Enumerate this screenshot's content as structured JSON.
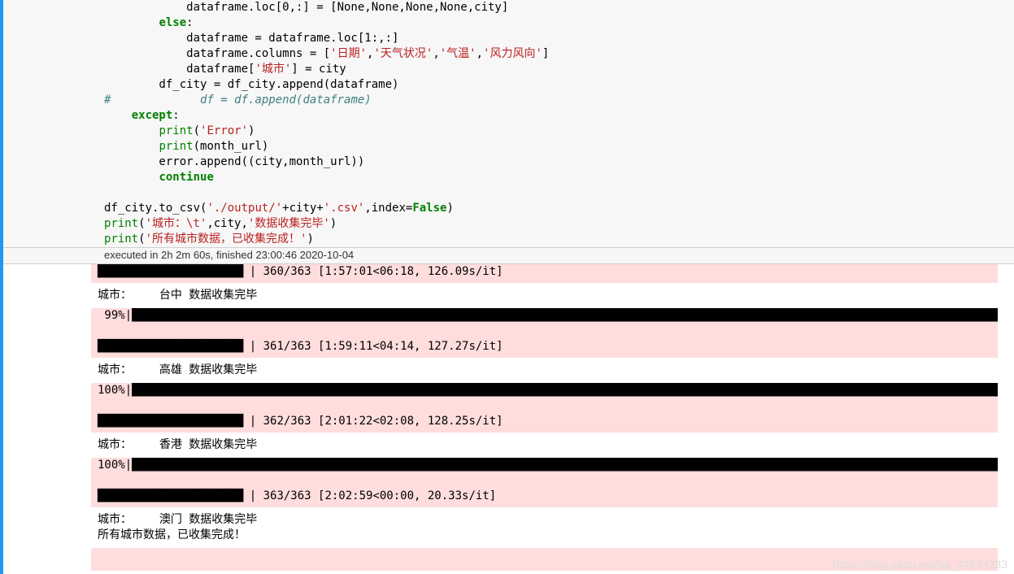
{
  "code": {
    "l0": "            dataframe.loc[0,:] = [None,None,None,None,city]",
    "l1_pre": "        ",
    "l1_kw": "else",
    "l1_post": ":",
    "l2": "            dataframe = dataframe.loc[1:,:]",
    "l3_pre": "            dataframe.columns = [",
    "l3_s1": "'日期'",
    "l3_c1": ",",
    "l3_s2": "'天气状况'",
    "l3_c2": ",",
    "l3_s3": "'气温'",
    "l3_c3": ",",
    "l3_s4": "'风力风向'",
    "l3_post": "]",
    "l4_pre": "            dataframe[",
    "l4_s": "'城市'",
    "l4_post": "] = city",
    "l5": "        df_city = df_city.append(dataframe)",
    "l6_pre": "#",
    "l6_rest": "             df = df.append(dataframe)",
    "l7_pre": "    ",
    "l7_kw": "except",
    "l7_post": ":",
    "l8_pre": "        ",
    "l8_fn": "print",
    "l8_op": "(",
    "l8_s": "'Error'",
    "l8_cp": ")",
    "l9_pre": "        ",
    "l9_fn": "print",
    "l9_rest": "(month_url)",
    "l10": "        error.append((city,month_url))",
    "l11_pre": "        ",
    "l11_kw": "continue",
    "l12": "",
    "l13_pre": "df_city.to_csv(",
    "l13_s1": "'./output/'",
    "l13_mid": "+city+",
    "l13_s2": "'.csv'",
    "l13_mid2": ",index=",
    "l13_kw": "False",
    "l13_post": ")",
    "l14_fn": "print",
    "l14_op": "(",
    "l14_s1": "'城市：\\t'",
    "l14_mid": ",city,",
    "l14_s2": "'数据收集完毕'",
    "l14_cp": ")",
    "l15_fn": "print",
    "l15_op": "(",
    "l15_s": "'所有城市数据，已收集完成！'",
    "l15_cp": ")"
  },
  "exec_info": "executed in 2h 2m 60s, finished 23:00:46 2020-10-04",
  "output": {
    "bar0_suffix": " | 360/363 [1:57:01<06:18, 126.09s/it]",
    "line0": "城市：\t 台中 数据收集完毕",
    "bar1_pct": " 99%|",
    "bar1_suffix": " | 361/363 [1:59:11<04:14, 127.27s/it]",
    "line1": "城市：\t 高雄 数据收集完毕",
    "bar2_pct": "100%|",
    "bar2_suffix": " | 362/363 [2:01:22<02:08, 128.25s/it]",
    "line2": "城市：\t 香港 数据收集完毕",
    "bar3_pct": "100%|",
    "bar3_suffix": " | 363/363 [2:02:59<00:00, 20.33s/it]",
    "line3": "城市：\t 澳门 数据收集完毕",
    "line4": "所有城市数据，已收集完成！"
  },
  "watermark": "https://blog.csdn.net/qq_44574333"
}
